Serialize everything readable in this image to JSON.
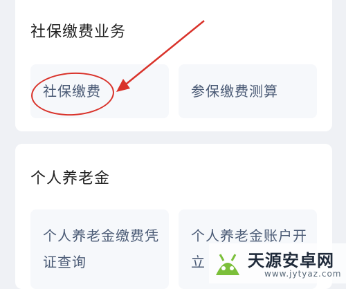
{
  "social_security_section": {
    "title": "社保缴费业务",
    "tiles": [
      {
        "label": "社保缴费"
      },
      {
        "label": "参保缴费测算"
      }
    ]
  },
  "pension_section": {
    "title": "个人养老金",
    "tiles": [
      {
        "label": "个人养老金缴费凭证查询"
      },
      {
        "label": "个人养老金账户开立"
      }
    ]
  },
  "watermark": {
    "name": "天源安卓网",
    "url": "www.jytyaz.com"
  },
  "colors": {
    "annotation": "#d9322a",
    "tile_text": "#4a5a75",
    "background": "#eff1f5"
  }
}
